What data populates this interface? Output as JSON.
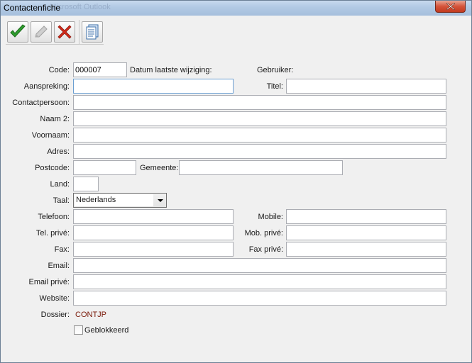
{
  "window": {
    "title": "Contactenfiche",
    "background_title": "...Microsoft Outlook"
  },
  "toolbar": {
    "buttons": [
      {
        "name": "accept-button",
        "icon": "checkmark-icon"
      },
      {
        "name": "edit-button",
        "icon": "pencil-icon"
      },
      {
        "name": "cancel-button",
        "icon": "cross-icon"
      },
      {
        "name": "notes-button",
        "icon": "document-icon"
      }
    ]
  },
  "form": {
    "code": {
      "label": "Code:",
      "value": "000007"
    },
    "datum_laatste_wijziging": {
      "label": "Datum laatste wijziging:",
      "value": ""
    },
    "gebruiker": {
      "label": "Gebruiker:",
      "value": ""
    },
    "aanspreking": {
      "label": "Aanspreking:",
      "value": ""
    },
    "titel": {
      "label": "Titel:",
      "value": ""
    },
    "contactpersoon": {
      "label": "Contactpersoon:",
      "value": ""
    },
    "naam2": {
      "label": "Naam 2:",
      "value": ""
    },
    "voornaam": {
      "label": "Voornaam:",
      "value": ""
    },
    "adres": {
      "label": "Adres:",
      "value": ""
    },
    "postcode": {
      "label": "Postcode:",
      "value": ""
    },
    "gemeente": {
      "label": "Gemeente:",
      "value": ""
    },
    "land": {
      "label": "Land:",
      "value": ""
    },
    "taal": {
      "label": "Taal:",
      "value": "Nederlands"
    },
    "telefoon": {
      "label": "Telefoon:",
      "value": ""
    },
    "mobile": {
      "label": "Mobile:",
      "value": ""
    },
    "tel_prive": {
      "label": "Tel. privé:",
      "value": ""
    },
    "mob_prive": {
      "label": "Mob. privé:",
      "value": ""
    },
    "fax": {
      "label": "Fax:",
      "value": ""
    },
    "fax_prive": {
      "label": "Fax privé:",
      "value": ""
    },
    "email": {
      "label": "Email:",
      "value": ""
    },
    "email_prive": {
      "label": "Email privé:",
      "value": ""
    },
    "website": {
      "label": "Website:",
      "value": ""
    },
    "dossier": {
      "label": "Dossier:",
      "value": "CONTJP"
    },
    "geblokkeerd": {
      "label": "Geblokkeerd",
      "checked": false
    }
  },
  "colors": {
    "dossier_value": "#7a1a0a",
    "titlebar": "#b1c9e4",
    "close_button": "#d4533a"
  }
}
